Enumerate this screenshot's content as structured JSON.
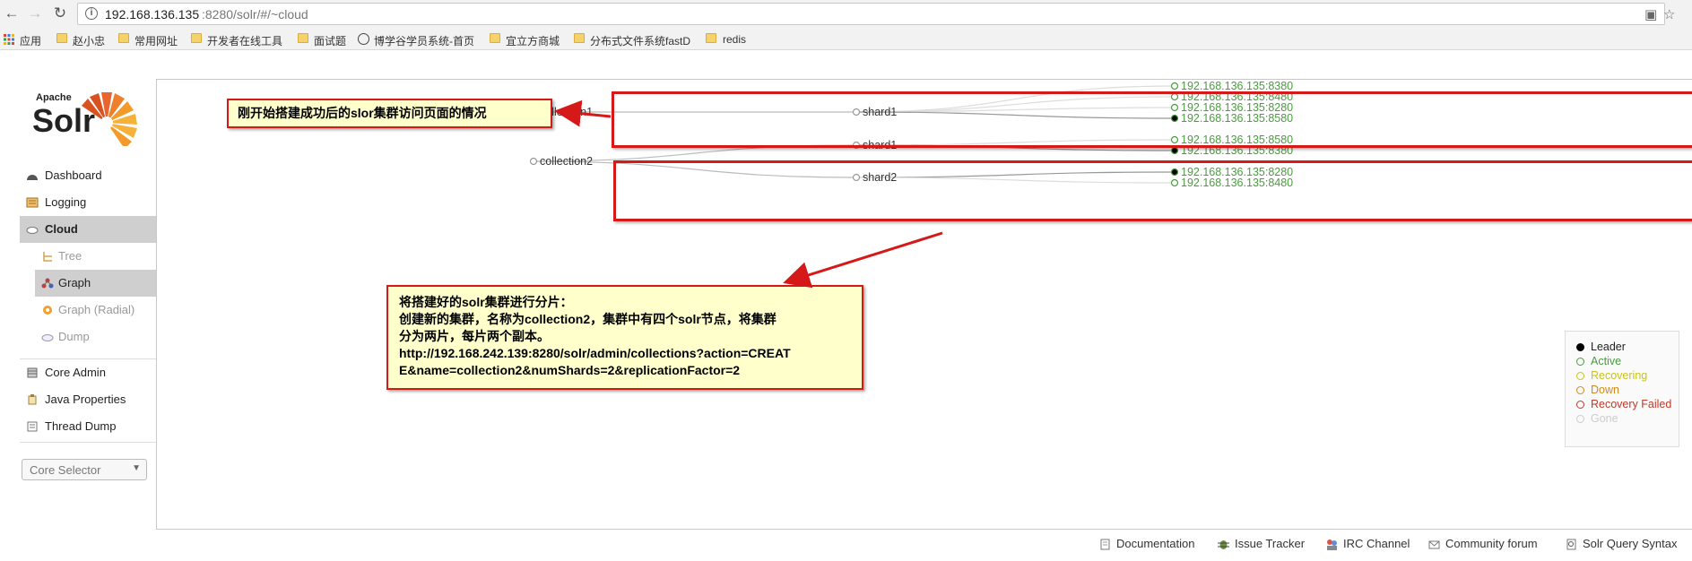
{
  "browser": {
    "address_host": "192.168.136.135",
    "address_path": ":8280/solr/#/~cloud",
    "bookmarks": [
      "应用",
      "赵小忠",
      "常用网址",
      "开发者在线工具",
      "面试题",
      "博学谷学员系统-首页",
      "宜立方商城",
      "分布式文件系统fastD",
      "redis"
    ]
  },
  "logo": {
    "apache": "Apache",
    "solr": "Solr"
  },
  "nav": {
    "items": [
      {
        "label": "Dashboard",
        "icon": "dashboard-icon"
      },
      {
        "label": "Logging",
        "icon": "logging-icon"
      },
      {
        "label": "Cloud",
        "icon": "cloud-icon"
      },
      {
        "label": "Tree",
        "icon": "tree-icon"
      },
      {
        "label": "Graph",
        "icon": "graph-icon"
      },
      {
        "label": "Graph (Radial)",
        "icon": "graph-radial-icon"
      },
      {
        "label": "Dump",
        "icon": "dump-icon"
      },
      {
        "label": "Core Admin",
        "icon": "core-admin-icon"
      },
      {
        "label": "Java Properties",
        "icon": "java-properties-icon"
      },
      {
        "label": "Thread Dump",
        "icon": "thread-dump-icon"
      }
    ],
    "core_selector": "Core Selector"
  },
  "graph": {
    "collections": [
      {
        "name": "collection1",
        "shards": [
          {
            "name": "shard1",
            "replicas": [
              {
                "address": "192.168.136.135:8380",
                "state": "active"
              },
              {
                "address": "192.168.136.135:8480",
                "state": "active"
              },
              {
                "address": "192.168.136.135:8280",
                "state": "active"
              },
              {
                "address": "192.168.136.135:8580",
                "state": "leader"
              }
            ]
          }
        ]
      },
      {
        "name": "collection2",
        "shards": [
          {
            "name": "shard1",
            "replicas": [
              {
                "address": "192.168.136.135:8580",
                "state": "active"
              },
              {
                "address": "192.168.136.135:8380",
                "state": "leader"
              }
            ]
          },
          {
            "name": "shard2",
            "replicas": [
              {
                "address": "192.168.136.135:8280",
                "state": "leader"
              },
              {
                "address": "192.168.136.135:8480",
                "state": "active"
              }
            ]
          }
        ]
      }
    ]
  },
  "legend": [
    {
      "label": "Leader",
      "color": "#000000",
      "fill": "#000000"
    },
    {
      "label": "Active",
      "color": "#4a9b3f",
      "fill": "none"
    },
    {
      "label": "Recovering",
      "color": "#c9c31a",
      "fill": "none"
    },
    {
      "label": "Down",
      "color": "#d08a1c",
      "fill": "none"
    },
    {
      "label": "Recovery Failed",
      "color": "#c0392b",
      "fill": "none"
    },
    {
      "label": "Gone",
      "color": "#cccccc",
      "fill": "none"
    }
  ],
  "annotations": {
    "top": "刚开始搭建成功后的slor集群访问页面的情况",
    "bottom": [
      "将搭建好的solr集群进行分片：",
      "创建新的集群，名称为collection2，集群中有四个solr节点，将集群",
      "分为两片，每片两个副本。",
      "http://192.168.242.139:8280/solr/admin/collections?action=CREAT",
      "E&name=collection2&numShards=2&replicationFactor=2"
    ]
  },
  "footer": [
    {
      "label": "Documentation",
      "icon": "documentation-icon"
    },
    {
      "label": "Issue Tracker",
      "icon": "issue-tracker-icon"
    },
    {
      "label": "IRC Channel",
      "icon": "irc-channel-icon"
    },
    {
      "label": "Community forum",
      "icon": "community-forum-icon"
    },
    {
      "label": "Solr Query Syntax",
      "icon": "solr-query-syntax-icon"
    }
  ],
  "colors": {
    "accent": "#d51919",
    "callout_bg": "#ffffcc",
    "ip_text": "#4a9b3f"
  }
}
